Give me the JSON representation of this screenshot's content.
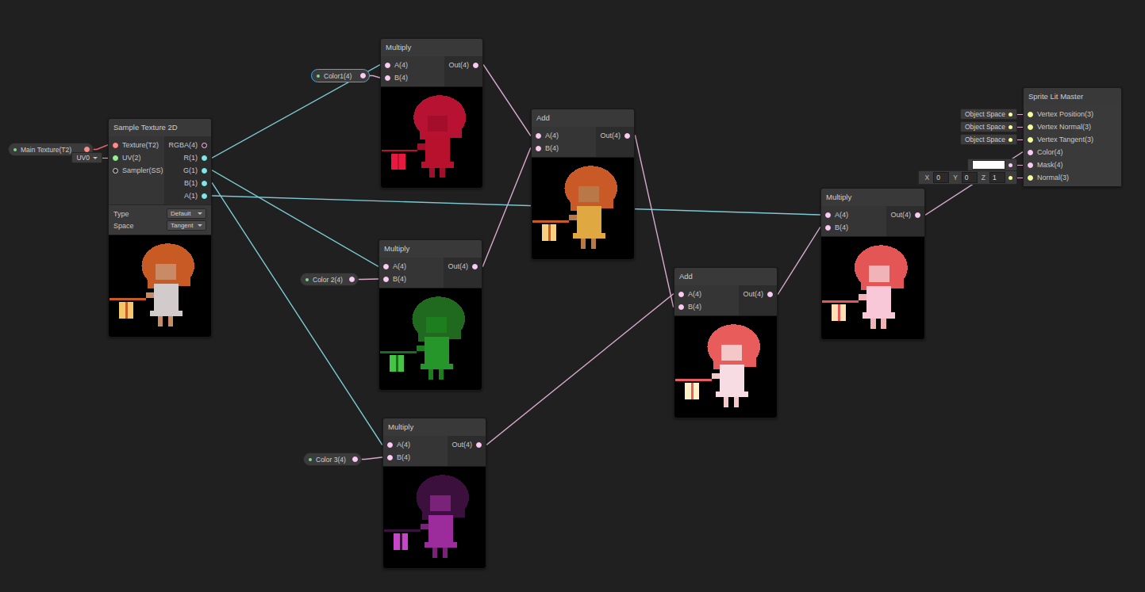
{
  "graph": {
    "properties": [
      {
        "label": "Main Texture(T2)",
        "kind": "texture2d",
        "selected": false
      },
      {
        "label": "Color1(4)",
        "kind": "vector4",
        "selected": true
      },
      {
        "label": "Color 2(4)",
        "kind": "vector4",
        "selected": false
      },
      {
        "label": "Color 3(4)",
        "kind": "vector4",
        "selected": false
      }
    ],
    "nodes": [
      {
        "title": "Sample Texture 2D",
        "inputs": [
          {
            "label": "Texture(T2)",
            "kind": "texture2d",
            "connected": true
          },
          {
            "label": "UV(2)",
            "kind": "vector2",
            "connected": true,
            "inline": {
              "kind": "dropdown",
              "text": "UV0"
            }
          },
          {
            "label": "Sampler(SS)",
            "kind": "sampler",
            "connected": false
          }
        ],
        "outputs": [
          {
            "label": "RGBA(4)",
            "kind": "vector4",
            "connected": false
          },
          {
            "label": "R(1)",
            "kind": "vector1",
            "connected": true
          },
          {
            "label": "G(1)",
            "kind": "vector1",
            "connected": true
          },
          {
            "label": "B(1)",
            "kind": "vector1",
            "connected": true
          },
          {
            "label": "A(1)",
            "kind": "vector1",
            "connected": true
          }
        ],
        "settings": [
          {
            "label": "Type",
            "value": "Default"
          },
          {
            "label": "Space",
            "value": "Tangent"
          }
        ],
        "preview": {
          "hair": "#c85a24",
          "skin": "#c98a66",
          "dress": "#d2cbcb",
          "lantern": "#f3c86a"
        }
      },
      {
        "title": "Multiply",
        "inputs": [
          {
            "label": "A(4)",
            "kind": "vector4",
            "connected": true
          },
          {
            "label": "B(4)",
            "kind": "vector4",
            "connected": true
          }
        ],
        "outputs": [
          {
            "label": "Out(4)",
            "kind": "vector4",
            "connected": true
          }
        ],
        "settings": [],
        "preview": {
          "hair": "#b81232",
          "skin": "#a30f2a",
          "dress": "#b8112e",
          "lantern": "#e8183e"
        }
      },
      {
        "title": "Multiply",
        "inputs": [
          {
            "label": "A(4)",
            "kind": "vector4",
            "connected": true
          },
          {
            "label": "B(4)",
            "kind": "vector4",
            "connected": true
          }
        ],
        "outputs": [
          {
            "label": "Out(4)",
            "kind": "vector4",
            "connected": true
          }
        ],
        "settings": [],
        "preview": {
          "hair": "#1f6a1f",
          "skin": "#1d7e1d",
          "dress": "#26962a",
          "lantern": "#46c446"
        }
      },
      {
        "title": "Multiply",
        "inputs": [
          {
            "label": "A(4)",
            "kind": "vector4",
            "connected": true
          },
          {
            "label": "B(4)",
            "kind": "vector4",
            "connected": true
          }
        ],
        "outputs": [
          {
            "label": "Out(4)",
            "kind": "vector4",
            "connected": true
          }
        ],
        "settings": [],
        "preview": {
          "hair": "#3c103c",
          "skin": "#7a227a",
          "dress": "#9c2c9c",
          "lantern": "#c844c8"
        }
      },
      {
        "title": "Add",
        "inputs": [
          {
            "label": "A(4)",
            "kind": "vector4",
            "connected": true
          },
          {
            "label": "B(4)",
            "kind": "vector4",
            "connected": true
          }
        ],
        "outputs": [
          {
            "label": "Out(4)",
            "kind": "vector4",
            "connected": true
          }
        ],
        "settings": [],
        "preview": {
          "hair": "#c95a28",
          "skin": "#b97848",
          "dress": "#e0a840",
          "lantern": "#f8d080"
        }
      },
      {
        "title": "Add",
        "inputs": [
          {
            "label": "A(4)",
            "kind": "vector4",
            "connected": true
          },
          {
            "label": "B(4)",
            "kind": "vector4",
            "connected": true
          }
        ],
        "outputs": [
          {
            "label": "Out(4)",
            "kind": "vector4",
            "connected": true
          }
        ],
        "settings": [],
        "preview": {
          "hair": "#e85c5c",
          "skin": "#f4c8c8",
          "dress": "#f8dce4",
          "lantern": "#fff0c8"
        }
      },
      {
        "title": "Multiply",
        "inputs": [
          {
            "label": "A(4)",
            "kind": "vector4",
            "connected": true
          },
          {
            "label": "B(4)",
            "kind": "vector4",
            "connected": true
          }
        ],
        "outputs": [
          {
            "label": "Out(4)",
            "kind": "vector4",
            "connected": true
          }
        ],
        "settings": [],
        "preview": {
          "hair": "#e45656",
          "skin": "#f0b4b8",
          "dress": "#f8c8d8",
          "lantern": "#ffe0b4"
        }
      },
      {
        "title": "Sprite Lit Master",
        "inputs": [
          {
            "label": "Vertex Position(3)",
            "kind": "vector3",
            "connected": true,
            "inline": {
              "kind": "label",
              "text": "Object Space"
            }
          },
          {
            "label": "Vertex Normal(3)",
            "kind": "vector3",
            "connected": true,
            "inline": {
              "kind": "label",
              "text": "Object Space"
            }
          },
          {
            "label": "Vertex Tangent(3)",
            "kind": "vector3",
            "connected": true,
            "inline": {
              "kind": "label",
              "text": "Object Space"
            }
          },
          {
            "label": "Color(4)",
            "kind": "vector4",
            "connected": true
          },
          {
            "label": "Mask(4)",
            "kind": "vector4",
            "connected": true,
            "inline": {
              "kind": "swatch",
              "color": "#ffffff"
            }
          },
          {
            "label": "Normal(3)",
            "kind": "vector3",
            "connected": true,
            "inline": {
              "kind": "vector",
              "fields": [
                {
                  "axis": "X",
                  "value": "0"
                },
                {
                  "axis": "Y",
                  "value": "0"
                },
                {
                  "axis": "Z",
                  "value": "1"
                }
              ]
            }
          }
        ],
        "outputs": [],
        "settings": [],
        "preview": null
      }
    ]
  }
}
